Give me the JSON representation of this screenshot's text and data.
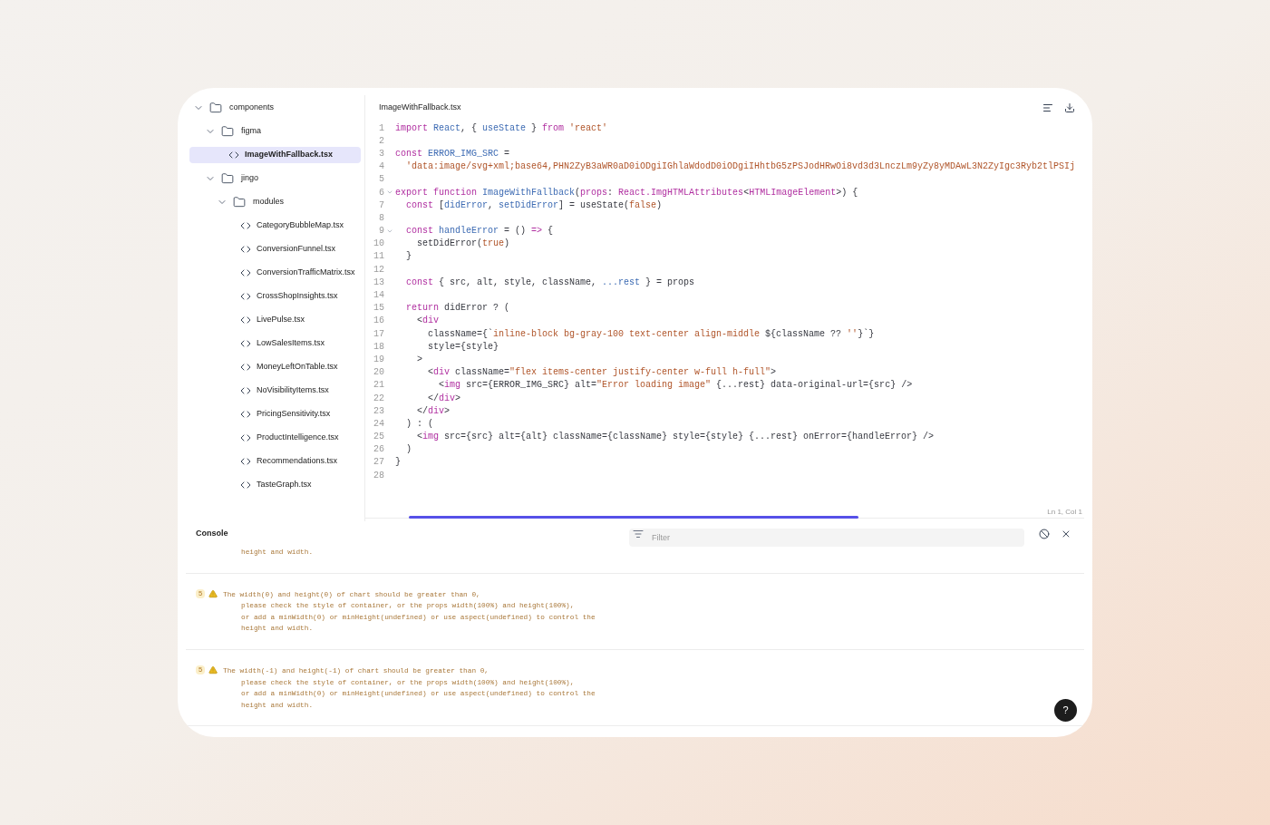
{
  "tree": [
    {
      "kind": "folder",
      "name": "components",
      "expanded": true,
      "children": [
        {
          "kind": "folder",
          "name": "figma",
          "expanded": true,
          "children": [
            {
              "kind": "file",
              "name": "ImageWithFallback.tsx",
              "selected": true
            }
          ]
        },
        {
          "kind": "folder",
          "name": "jingo",
          "expanded": true,
          "children": [
            {
              "kind": "folder",
              "name": "modules",
              "expanded": true,
              "children": [
                {
                  "kind": "file",
                  "name": "CategoryBubbleMap.tsx",
                  "selected": false
                },
                {
                  "kind": "file",
                  "name": "ConversionFunnel.tsx",
                  "selected": false
                },
                {
                  "kind": "file",
                  "name": "ConversionTrafficMatrix.tsx",
                  "selected": false
                },
                {
                  "kind": "file",
                  "name": "CrossShopInsights.tsx",
                  "selected": false
                },
                {
                  "kind": "file",
                  "name": "LivePulse.tsx",
                  "selected": false
                },
                {
                  "kind": "file",
                  "name": "LowSalesItems.tsx",
                  "selected": false
                },
                {
                  "kind": "file",
                  "name": "MoneyLeftOnTable.tsx",
                  "selected": false
                },
                {
                  "kind": "file",
                  "name": "NoVisibilityItems.tsx",
                  "selected": false
                },
                {
                  "kind": "file",
                  "name": "PricingSensitivity.tsx",
                  "selected": false
                },
                {
                  "kind": "file",
                  "name": "ProductIntelligence.tsx",
                  "selected": false
                },
                {
                  "kind": "file",
                  "name": "Recommendations.tsx",
                  "selected": false
                },
                {
                  "kind": "file",
                  "name": "TasteGraph.tsx",
                  "selected": false
                }
              ]
            }
          ]
        }
      ]
    }
  ],
  "editor": {
    "filename": "ImageWithFallback.tsx",
    "cursor": "Ln 1, Col 1",
    "lines": [
      {
        "number": "1",
        "tokens": [
          {
            "kind": "keyword",
            "text": "import "
          },
          {
            "kind": "name",
            "text": "React"
          },
          {
            "kind": "plain",
            "text": ", { "
          },
          {
            "kind": "name",
            "text": "useState"
          },
          {
            "kind": "plain",
            "text": " } "
          },
          {
            "kind": "keyword",
            "text": "from "
          },
          {
            "kind": "string",
            "text": "'react'"
          }
        ]
      },
      {
        "number": "2"
      },
      {
        "number": "3",
        "tokens": [
          {
            "kind": "keyword",
            "text": "const "
          },
          {
            "kind": "name",
            "text": "ERROR_IMG_SRC"
          },
          {
            "kind": "plain",
            "text": " ="
          }
        ]
      },
      {
        "number": "4",
        "tokens": [
          {
            "kind": "string",
            "text": "  'data:image/svg+xml;base64,PHN2ZyB3aWR0aD0iODgiIGhlaWdodD0iODgiIHhtbG5zPSJodHRwOi8vd3d3LnczLm9yZy8yMDAwL3N2ZyIgc3Ryb2tlPSIj"
          }
        ]
      },
      {
        "number": "5"
      },
      {
        "number": "6",
        "foldable": true,
        "tokens": [
          {
            "kind": "keyword",
            "text": "export function "
          },
          {
            "kind": "name",
            "text": "ImageWithFallback"
          },
          {
            "kind": "plain",
            "text": "("
          },
          {
            "kind": "keyword",
            "text": "props"
          },
          {
            "kind": "plain",
            "text": ": "
          },
          {
            "kind": "keyword",
            "text": "React.ImgHTMLAttributes"
          },
          {
            "kind": "plain",
            "text": "<"
          },
          {
            "kind": "keyword",
            "text": "HTMLImageElement"
          },
          {
            "kind": "plain",
            "text": ">) {"
          }
        ]
      },
      {
        "number": "7",
        "tokens": [
          {
            "kind": "keyword",
            "text": "  const "
          },
          {
            "kind": "plain",
            "text": "["
          },
          {
            "kind": "name",
            "text": "didError"
          },
          {
            "kind": "plain",
            "text": ", "
          },
          {
            "kind": "name",
            "text": "setDidError"
          },
          {
            "kind": "plain",
            "text": "] = useState("
          },
          {
            "kind": "string",
            "text": "false"
          },
          {
            "kind": "plain",
            "text": ")"
          }
        ]
      },
      {
        "number": "8"
      },
      {
        "number": "9",
        "foldable": true,
        "tokens": [
          {
            "kind": "keyword",
            "text": "  const "
          },
          {
            "kind": "name",
            "text": "handleError"
          },
          {
            "kind": "plain",
            "text": " = () "
          },
          {
            "kind": "keyword",
            "text": "=>"
          },
          {
            "kind": "plain",
            "text": " {"
          }
        ]
      },
      {
        "number": "10",
        "tokens": [
          {
            "kind": "plain",
            "text": "    setDidError("
          },
          {
            "kind": "string",
            "text": "true"
          },
          {
            "kind": "plain",
            "text": ")"
          }
        ]
      },
      {
        "number": "11",
        "tokens": [
          {
            "kind": "plain",
            "text": "  }"
          }
        ]
      },
      {
        "number": "12"
      },
      {
        "number": "13",
        "tokens": [
          {
            "kind": "keyword",
            "text": "  const "
          },
          {
            "kind": "plain",
            "text": "{ src, alt, style, className, "
          },
          {
            "kind": "name",
            "text": "...rest"
          },
          {
            "kind": "plain",
            "text": " } = props"
          }
        ]
      },
      {
        "number": "14"
      },
      {
        "number": "15",
        "tokens": [
          {
            "kind": "keyword",
            "text": "  return "
          },
          {
            "kind": "plain",
            "text": "didError ? ("
          }
        ]
      },
      {
        "number": "16",
        "tokens": [
          {
            "kind": "plain",
            "text": "    <"
          },
          {
            "kind": "keyword",
            "text": "div"
          }
        ]
      },
      {
        "number": "17",
        "tokens": [
          {
            "kind": "plain",
            "text": "      className={`"
          },
          {
            "kind": "string",
            "text": "inline-block bg-gray-100 text-center align-middle "
          },
          {
            "kind": "plain",
            "text": "${className ?? "
          },
          {
            "kind": "string",
            "text": "''"
          },
          {
            "kind": "plain",
            "text": "}`}"
          }
        ]
      },
      {
        "number": "18",
        "tokens": [
          {
            "kind": "plain",
            "text": "      style={style}"
          }
        ]
      },
      {
        "number": "19",
        "tokens": [
          {
            "kind": "plain",
            "text": "    >"
          }
        ]
      },
      {
        "number": "20",
        "tokens": [
          {
            "kind": "plain",
            "text": "      <"
          },
          {
            "kind": "keyword",
            "text": "div"
          },
          {
            "kind": "plain",
            "text": " className="
          },
          {
            "kind": "string",
            "text": "\"flex items-center justify-center w-full h-full\""
          },
          {
            "kind": "plain",
            "text": ">"
          }
        ]
      },
      {
        "number": "21",
        "tokens": [
          {
            "kind": "plain",
            "text": "        <"
          },
          {
            "kind": "keyword",
            "text": "img"
          },
          {
            "kind": "plain",
            "text": " src={ERROR_IMG_SRC} alt="
          },
          {
            "kind": "string",
            "text": "\"Error loading image\""
          },
          {
            "kind": "plain",
            "text": " {...rest} data-original-url={src} />"
          }
        ]
      },
      {
        "number": "22",
        "tokens": [
          {
            "kind": "plain",
            "text": "      </"
          },
          {
            "kind": "keyword",
            "text": "div"
          },
          {
            "kind": "plain",
            "text": ">"
          }
        ]
      },
      {
        "number": "23",
        "tokens": [
          {
            "kind": "plain",
            "text": "    </"
          },
          {
            "kind": "keyword",
            "text": "div"
          },
          {
            "kind": "plain",
            "text": ">"
          }
        ]
      },
      {
        "number": "24",
        "tokens": [
          {
            "kind": "plain",
            "text": "  ) : ("
          }
        ]
      },
      {
        "number": "25",
        "tokens": [
          {
            "kind": "plain",
            "text": "    <"
          },
          {
            "kind": "keyword",
            "text": "img"
          },
          {
            "kind": "plain",
            "text": " src={src} alt={alt} className={className} style={style} {...rest} onError={handleError} />"
          }
        ]
      },
      {
        "number": "26",
        "tokens": [
          {
            "kind": "plain",
            "text": "  )"
          }
        ]
      },
      {
        "number": "27",
        "tokens": [
          {
            "kind": "plain",
            "text": "}"
          }
        ]
      },
      {
        "number": "28"
      }
    ]
  },
  "console": {
    "title": "Console",
    "filter": {
      "placeholder": "Filter"
    },
    "entries": [
      {
        "lines": [
          "height and width."
        ]
      },
      {
        "count": "5",
        "kind": "warning",
        "lines": [
          "The width(0) and height(0) of chart should be greater than 0,",
          "please check the style of container, or the props width(100%) and height(100%),",
          "or add a minWidth(0) or minHeight(undefined) or use aspect(undefined) to control the",
          "height and width."
        ]
      },
      {
        "count": "5",
        "kind": "warning",
        "lines": [
          "The width(-1) and height(-1) of chart should be greater than 0,",
          "please check the style of container, or the props width(100%) and height(100%),",
          "or add a minWidth(0) or minHeight(undefined) or use aspect(undefined) to control the",
          "height and width."
        ]
      }
    ]
  },
  "help": {
    "label": "?"
  }
}
